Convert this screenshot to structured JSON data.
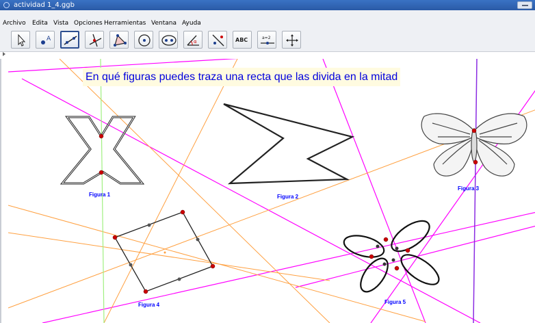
{
  "window": {
    "title": "actividad 1_4.ggb"
  },
  "menu": {
    "items": [
      {
        "label": "Archivo"
      },
      {
        "label": "Edita"
      },
      {
        "label": "Vista"
      },
      {
        "label": "Opciones"
      },
      {
        "label": "Herramientas"
      },
      {
        "label": "Ventana"
      },
      {
        "label": "Ayuda"
      }
    ]
  },
  "toolbar": {
    "tools": [
      {
        "icon": "pointer-icon"
      },
      {
        "icon": "point-icon",
        "label": "A"
      },
      {
        "icon": "line-icon",
        "active": true
      },
      {
        "icon": "perpendicular-icon"
      },
      {
        "icon": "polygon-icon"
      },
      {
        "icon": "circle-icon"
      },
      {
        "icon": "ellipse-icon"
      },
      {
        "icon": "angle-icon",
        "label": "α"
      },
      {
        "icon": "reflect-icon"
      },
      {
        "icon": "text-tool-icon",
        "label": "ABC"
      },
      {
        "icon": "slider-icon",
        "label": "a=2"
      },
      {
        "icon": "move-view-icon"
      }
    ]
  },
  "canvas": {
    "question": "En qué figuras puedes traza una recta que las divida en la mitad",
    "figures": [
      {
        "label": "Figura 1"
      },
      {
        "label": "Figura 2"
      },
      {
        "label": "Figura 3"
      },
      {
        "label": "Figura 4"
      },
      {
        "label": "Figura 5"
      }
    ],
    "colors": {
      "magenta_lines": "#ff00ff",
      "orange_lines": "#ffa040",
      "green_line": "#a0f080",
      "purple_line": "#8a2be2",
      "points": "#cc0000",
      "label_text": "#0000ff"
    }
  }
}
